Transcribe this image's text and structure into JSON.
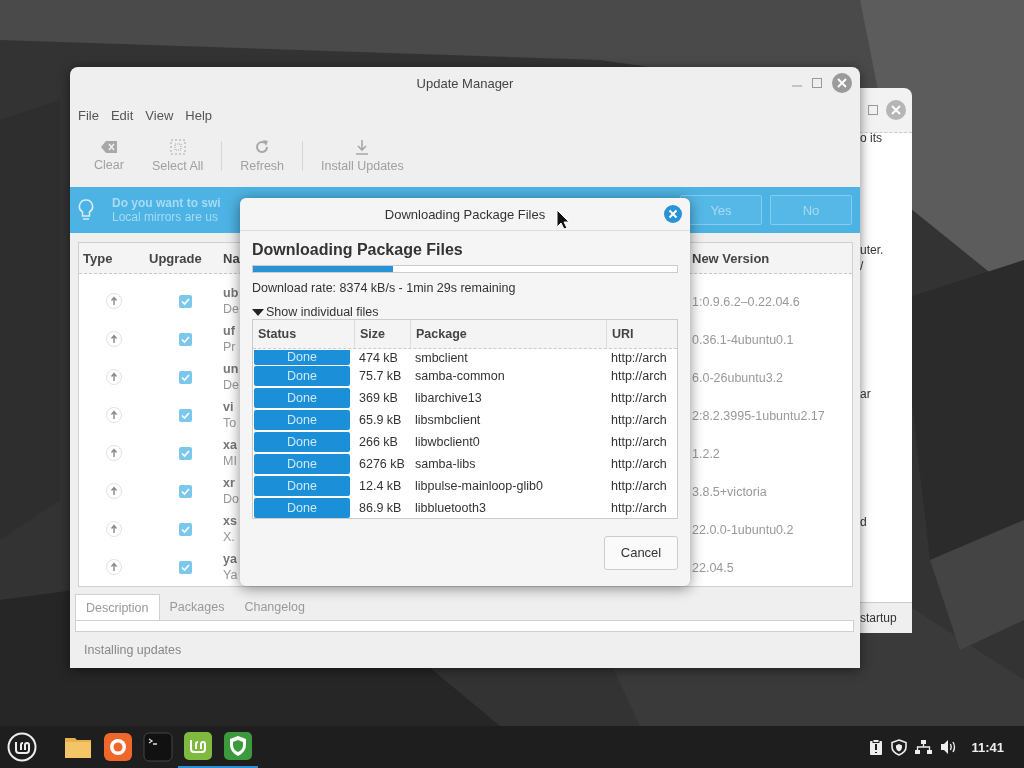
{
  "background_window": {
    "texts": [
      "o its",
      "uter.",
      "/",
      "ar",
      "d"
    ],
    "footer": "startup"
  },
  "window": {
    "title": "Update Manager"
  },
  "menu": [
    "File",
    "Edit",
    "View",
    "Help"
  ],
  "toolbar": [
    {
      "kind": "button",
      "label": "Clear",
      "disabled": true
    },
    {
      "kind": "button",
      "label": "Select All",
      "disabled": true
    },
    {
      "kind": "separator"
    },
    {
      "kind": "button",
      "label": "Refresh",
      "disabled": true
    },
    {
      "kind": "separator"
    },
    {
      "kind": "button",
      "label": "Install Updates",
      "disabled": true
    }
  ],
  "info_bar": {
    "title": "Do you want to swi",
    "text": "Local mirrors are us",
    "buttons": [
      "Yes",
      "No"
    ]
  },
  "table": {
    "columns": [
      "Type",
      "Upgrade",
      "Na",
      "New Version"
    ],
    "rows": [
      {
        "checked": true,
        "name": "ub",
        "description": "De",
        "new_version": "1:0.9.6.2–0.22.04.6"
      },
      {
        "checked": true,
        "name": "uf",
        "description": "Pr",
        "new_version": "0.36.1-4ubuntu0.1"
      },
      {
        "checked": true,
        "name": "un",
        "description": "De",
        "new_version": "6.0-26ubuntu3.2"
      },
      {
        "checked": true,
        "name": "vi",
        "description": "To",
        "new_version": "2:8.2.3995-1ubuntu2.17"
      },
      {
        "checked": true,
        "name": "xa",
        "description": "MI",
        "new_version": "1.2.2"
      },
      {
        "checked": true,
        "name": "xr",
        "description": "Do",
        "new_version": "3.8.5+victoria"
      },
      {
        "checked": true,
        "name": "xs",
        "description": "X.",
        "new_version": "22.0.0-1ubuntu0.2"
      },
      {
        "checked": true,
        "name": "ya",
        "description": "Ya",
        "new_version": "22.04.5"
      }
    ]
  },
  "tabs": [
    {
      "label": "Description",
      "selected": true
    },
    {
      "label": "Packages",
      "selected": false
    },
    {
      "label": "Changelog",
      "selected": false
    }
  ],
  "status_bar": "Installing updates",
  "dialog": {
    "title": "Downloading Package Files",
    "heading": "Downloading Package Files",
    "progress": {
      "level": 0.33
    },
    "rate": "Download rate: 8374 kB/s - 1min 29s remaining",
    "expander": {
      "label": "Show individual files",
      "expanded": true
    },
    "columns": [
      "Status",
      "Size",
      "Package",
      "URI"
    ],
    "rows": [
      {
        "status": "Done",
        "size": "474 kB",
        "package": "smbclient",
        "uri": "http://arch"
      },
      {
        "status": "Done",
        "size": "75.7 kB",
        "package": "samba-common",
        "uri": "http://arch"
      },
      {
        "status": "Done",
        "size": "369 kB",
        "package": "libarchive13",
        "uri": "http://arch"
      },
      {
        "status": "Done",
        "size": "65.9 kB",
        "package": "libsmbclient",
        "uri": "http://arch"
      },
      {
        "status": "Done",
        "size": "266 kB",
        "package": "libwbclient0",
        "uri": "http://arch"
      },
      {
        "status": "Done",
        "size": "6276 kB",
        "package": "samba-libs",
        "uri": "http://arch"
      },
      {
        "status": "Done",
        "size": "12.4 kB",
        "package": "libpulse-mainloop-glib0",
        "uri": "http://arch"
      },
      {
        "status": "Done",
        "size": "86.9 kB",
        "package": "libbluetooth3",
        "uri": "http://arch"
      }
    ],
    "buttons": [
      "Cancel"
    ]
  },
  "taskbar": {
    "apps": [
      {
        "running": false
      },
      {
        "running": false
      },
      {
        "running": false
      },
      {
        "running": true
      },
      {
        "running": true
      }
    ],
    "clock": "11:41"
  }
}
